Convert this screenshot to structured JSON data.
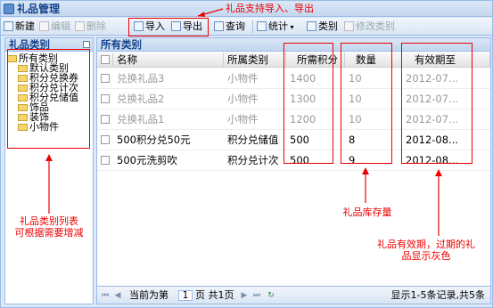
{
  "window": {
    "title": "礼品管理"
  },
  "toolbar": {
    "new": "新建",
    "edit": "编辑",
    "delete": "删除",
    "import": "导入",
    "export": "导出",
    "query": "查询",
    "stats": "统计",
    "category": "类别",
    "edit_category": "修改类别"
  },
  "left": {
    "title": "礼品类别",
    "tree": [
      "所有类别",
      "默认类别",
      "积分兑换券",
      "积分兑计次",
      "积分兑储值",
      "饰品",
      "装饰",
      "小物件"
    ]
  },
  "grid": {
    "title": "所有类别",
    "columns": [
      "名称",
      "所属类别",
      "所需积分",
      "数量",
      "有效期至"
    ],
    "rows": [
      [
        "兑换礼品3",
        "小物件",
        "1400",
        "10",
        "2012-07..."
      ],
      [
        "兑换礼品2",
        "小物件",
        "1300",
        "10",
        "2012-07..."
      ],
      [
        "兑换礼品1",
        "小物件",
        "1200",
        "10",
        "2012-07..."
      ],
      [
        "500积分兑50元",
        "积分兑储值",
        "500",
        "8",
        "2012-08..."
      ],
      [
        "500元洗剪吹",
        "积分兑计次",
        "500",
        "9",
        "2012-08..."
      ]
    ]
  },
  "pager": {
    "before": "当前为第",
    "page": "1",
    "after": "页 共1页",
    "info": "显示1-5条记录,共5条"
  },
  "annotations": {
    "import_export": "礼品支持导入、导出",
    "category_list": "礼品类别列表\n可根据需要增减",
    "stock": "礼品库存量",
    "expiry": "礼品有效期，过期的礼\n品显示灰色"
  }
}
